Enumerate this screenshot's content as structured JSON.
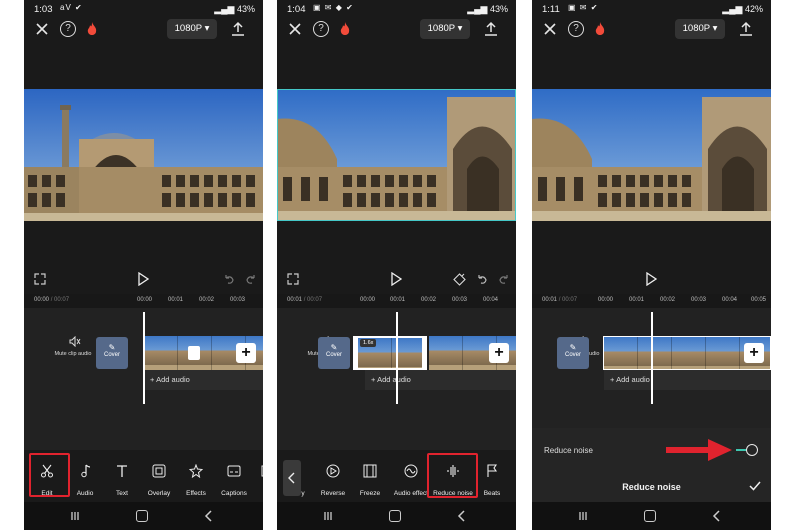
{
  "colors": {
    "highlight": "#e0232e",
    "accent_teal": "#3fc7b0",
    "arrow": "#e0232e"
  },
  "screens": [
    {
      "status": {
        "time": "1:03",
        "battery": "43%"
      },
      "resolution": "1080P",
      "timecode": {
        "current": "00:00",
        "total": "/ 00:07"
      },
      "ruler_ticks": [
        "00:00",
        "00:01",
        "00:02",
        "00:03"
      ],
      "mute_label": "Mute clip audio",
      "cover_label": "Cover",
      "add_audio": "Add audio",
      "tools": [
        {
          "label": "Edit",
          "icon": "scissors-icon"
        },
        {
          "label": "Audio",
          "icon": "music-note-icon"
        },
        {
          "label": "Text",
          "icon": "text-icon"
        },
        {
          "label": "Overlay",
          "icon": "overlay-icon"
        },
        {
          "label": "Effects",
          "icon": "effects-icon"
        },
        {
          "label": "Captions",
          "icon": "captions-icon"
        },
        {
          "label": "As",
          "icon": "aspect-icon"
        }
      ]
    },
    {
      "status": {
        "time": "1:04",
        "battery": "43%"
      },
      "resolution": "1080P",
      "timecode": {
        "current": "00:01",
        "total": "/ 00:07"
      },
      "ruler_ticks": [
        "00:00",
        "00:01",
        "00:02",
        "00:03",
        "00:04"
      ],
      "mute_label": "Mute clip audio",
      "cover_label": "Cover",
      "speed_badge": "1.6x",
      "add_audio": "Add audio",
      "tools": [
        {
          "label": "y",
          "icon": "copy-icon"
        },
        {
          "label": "Reverse",
          "icon": "reverse-icon"
        },
        {
          "label": "Freeze",
          "icon": "freeze-icon"
        },
        {
          "label": "Audio effect",
          "icon": "audio-effect-icon"
        },
        {
          "label": "Reduce noise",
          "icon": "reduce-noise-icon"
        },
        {
          "label": "Beats",
          "icon": "beats-icon"
        }
      ]
    },
    {
      "status": {
        "time": "1:11",
        "battery": "42%"
      },
      "resolution": "1080P",
      "timecode": {
        "current": "00:01",
        "total": "/ 00:07"
      },
      "ruler_ticks": [
        "00:00",
        "00:01",
        "00:02",
        "00:03",
        "00:04",
        "00:05"
      ],
      "mute_label": "Mute clip audio",
      "cover_label": "Cover",
      "add_audio": "Add audio",
      "reduce_noise": {
        "label": "Reduce noise",
        "title": "Reduce noise",
        "enabled": true
      }
    }
  ]
}
